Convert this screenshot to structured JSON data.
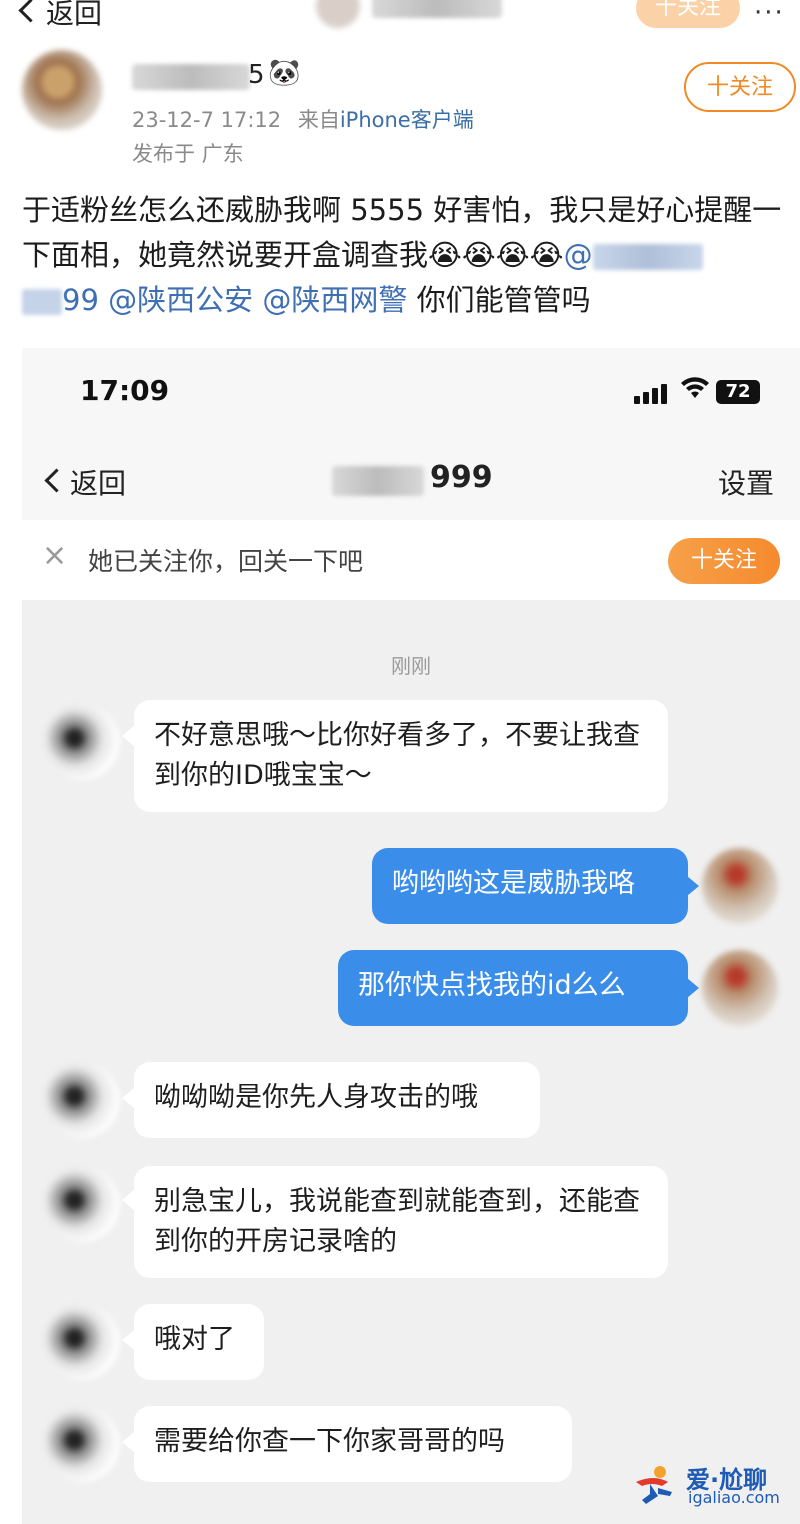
{
  "top_nav": {
    "back_label": "返回",
    "follow_label": "十关注",
    "more": "···"
  },
  "post": {
    "name_suffix": "5",
    "badge_emoji": "🐼",
    "date": "23-12-7 17:12",
    "source_prefix": "来自",
    "source": "iPhone客户端",
    "location": "发布于 广东",
    "follow_label": "十关注",
    "text_part1": "于适粉丝怎么还威胁我啊 5555 好害怕，我只是好心提醒一下面相，她竟然说要开盒调查我",
    "crying_emojis": "😭😭😭😭",
    "mention_at": "@",
    "mention_tail": "99",
    "mention_2": "@陕西公安",
    "mention_3": "@陕西网警",
    "text_part2": " 你们能管管吗"
  },
  "screenshot": {
    "status": {
      "time": "17:09",
      "wifi_icon": "wifi-icon",
      "battery": "72"
    },
    "nav": {
      "back_label": "返回",
      "title_suffix": "999",
      "settings": "设置"
    },
    "follow_banner": {
      "close": "×",
      "text": "她已关注你，回关一下吧",
      "button": "十关注"
    },
    "timestamp": "刚刚",
    "messages": [
      {
        "side": "in",
        "text": "不好意思哦～比你好看多了，不要让我查到你的ID哦宝宝～"
      },
      {
        "side": "out",
        "text": "哟哟哟这是威胁我咯"
      },
      {
        "side": "out",
        "text": "那你快点找我的id么么"
      },
      {
        "side": "in",
        "text": "呦呦呦是你先人身攻击的哦"
      },
      {
        "side": "in",
        "text": "别急宝儿，我说能查到就能查到，还能查到你的开房记录啥的"
      },
      {
        "side": "in",
        "text": "哦对了"
      },
      {
        "side": "in",
        "text": "需要给你查一下你家哥哥的吗"
      }
    ]
  },
  "watermark": {
    "name": "爱·尬聊",
    "url": "igaliao.com",
    "brand_color": "#1f5bb5"
  },
  "colors": {
    "accent_orange": "#f08a24",
    "bubble_blue": "#3a8eea",
    "mention_blue": "#3f6fb3"
  }
}
